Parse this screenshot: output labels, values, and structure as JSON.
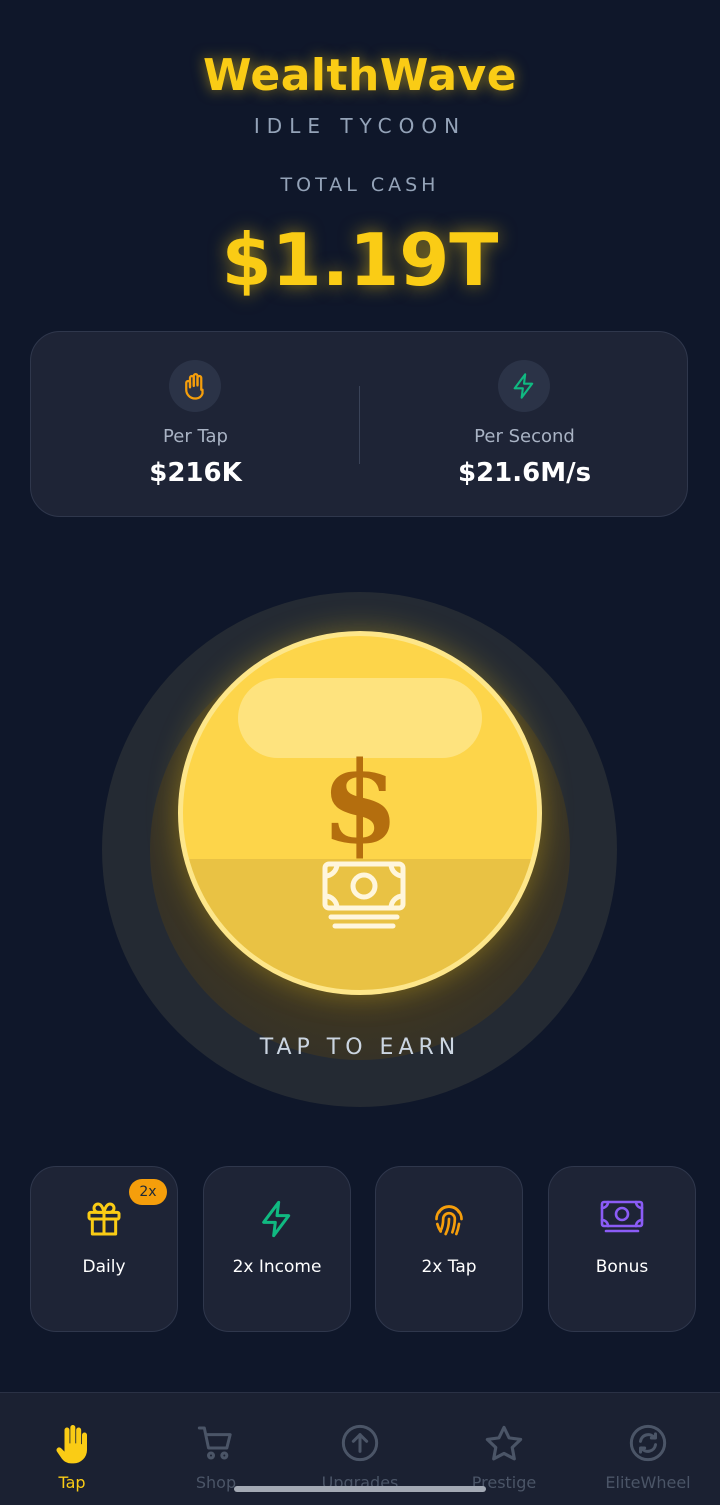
{
  "header": {
    "title": "WealthWave",
    "subtitle": "IDLE TYCOON"
  },
  "cash": {
    "label": "TOTAL CASH",
    "value": "$1.19T"
  },
  "stats": {
    "per_tap": {
      "label": "Per Tap",
      "value": "$216K",
      "icon": "hand-icon",
      "color": "#f59e0b"
    },
    "per_second": {
      "label": "Per Second",
      "value": "$21.6M/s",
      "icon": "lightning-icon",
      "color": "#10b981"
    }
  },
  "tap": {
    "label": "TAP TO EARN",
    "coin_symbol": "$",
    "coin_color": "#fdd54a"
  },
  "actions": [
    {
      "label": "Daily",
      "icon": "gift-icon",
      "badge": "2x",
      "color": "#facc15"
    },
    {
      "label": "2x Income",
      "icon": "lightning-icon",
      "color": "#10b981"
    },
    {
      "label": "2x Tap",
      "icon": "fingerprint-icon",
      "color": "#f59e0b"
    },
    {
      "label": "Bonus",
      "icon": "cash-icon",
      "color": "#8b5cf6"
    }
  ],
  "nav": {
    "active_color": "#facc15",
    "inactive_color": "#4b5567",
    "items": [
      {
        "label": "Tap",
        "icon": "hand-icon",
        "active": true
      },
      {
        "label": "Shop",
        "icon": "cart-icon",
        "active": false
      },
      {
        "label": "Upgrades",
        "icon": "arrow-up-circle-icon",
        "active": false
      },
      {
        "label": "Prestige",
        "icon": "star-icon",
        "active": false
      },
      {
        "label": "EliteWheel",
        "icon": "refresh-circle-icon",
        "active": false
      }
    ]
  }
}
